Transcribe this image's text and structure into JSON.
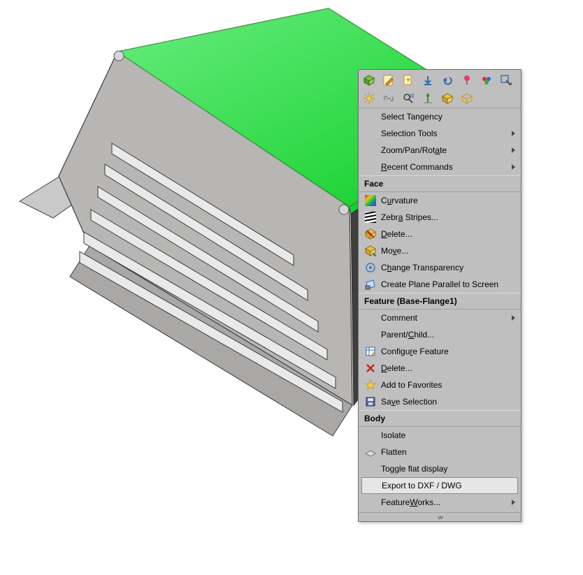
{
  "menu": {
    "items_top": [
      {
        "label": "Select Tangency"
      },
      {
        "label": "Selection Tools",
        "submenu": true
      },
      {
        "label": "Zoom/Pan/Rotate",
        "submenu": true,
        "accel_index": 8
      },
      {
        "label": "Recent Commands",
        "submenu": true,
        "accel_index": 0
      }
    ],
    "section_face": "Face",
    "items_face": [
      {
        "icon": "curvature-icon",
        "label": "Curvature",
        "accel": "u"
      },
      {
        "icon": "zebra-icon",
        "label": "Zebra Stripes...",
        "accel": "a"
      },
      {
        "icon": "delete-icon",
        "label": "Delete...",
        "accel": "D"
      },
      {
        "icon": "move-icon",
        "label": "Move...",
        "accel": "v"
      },
      {
        "icon": "transparency-icon",
        "label": "Change Transparency",
        "accel": "h"
      },
      {
        "icon": "plane-icon",
        "label": "Create Plane Parallel to Screen"
      }
    ],
    "section_feature": "Feature (Base-Flange1)",
    "items_feature": [
      {
        "icon": "",
        "label": "Comment",
        "submenu": true
      },
      {
        "icon": "",
        "label": "Parent/Child...",
        "accel": "C"
      },
      {
        "icon": "configure-icon",
        "label": "Configure Feature",
        "accel": "r"
      },
      {
        "icon": "delete-x-icon",
        "label": "Delete...",
        "accel": "D"
      },
      {
        "icon": "favorite-icon",
        "label": "Add to Favorites"
      },
      {
        "icon": "save-sel-icon",
        "label": "Save Selection",
        "accel": "v"
      }
    ],
    "section_body": "Body",
    "items_body": [
      {
        "icon": "",
        "label": "Isolate"
      },
      {
        "icon": "flatten-icon",
        "label": "Flatten"
      },
      {
        "icon": "",
        "label": "Toggle flat display"
      },
      {
        "icon": "",
        "label": "Export to DXF / DWG",
        "highlight": true
      },
      {
        "icon": "",
        "label": "FeatureWorks...",
        "submenu": true,
        "accel": "W"
      }
    ]
  },
  "toolbar": {
    "row1": [
      "feature-cube-icon",
      "edit-sketch-icon",
      "doc-arrows-icon",
      "arrow-down-icon",
      "undo-icon",
      "paint-icon",
      "palette-icon"
    ],
    "row2": [
      "preselect-icon",
      "sun-icon",
      "link-icon",
      "zoom-fit-icon",
      "axis-icon",
      "box-solid-icon",
      "box-wire-icon"
    ]
  }
}
